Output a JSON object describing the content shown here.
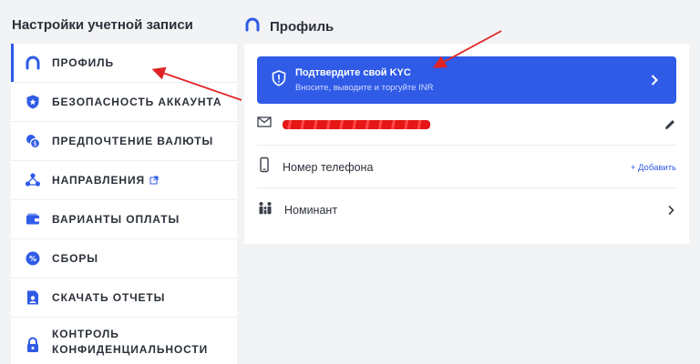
{
  "sidebar": {
    "title": "Настройки учетной записи",
    "items": [
      {
        "label": "Профиль",
        "icon": "profile-icon"
      },
      {
        "label": "Безопасность аккаунта",
        "icon": "shield-icon"
      },
      {
        "label": "Предпочтение валюты",
        "icon": "currency-icon"
      },
      {
        "label": "Направления",
        "icon": "referral-icon"
      },
      {
        "label": "Варианты оплаты",
        "icon": "wallet-icon"
      },
      {
        "label": "Сборы",
        "icon": "percent-icon"
      },
      {
        "label": "Скачать отчеты",
        "icon": "report-icon"
      },
      {
        "label": "Контроль конфиденциальности",
        "icon": "privacy-lock-icon"
      }
    ]
  },
  "main": {
    "title": "Профиль",
    "kyc": {
      "title": "Подтвердите свой KYC",
      "subtitle": "Вносите, выводите и торгуйте INR"
    },
    "rows": {
      "phone_label": "Номер телефона",
      "add_link": "+ Добавить",
      "nominee_label": "Номинант"
    }
  },
  "colors": {
    "accent": "#2f5be7",
    "annotation": "#e02424"
  }
}
